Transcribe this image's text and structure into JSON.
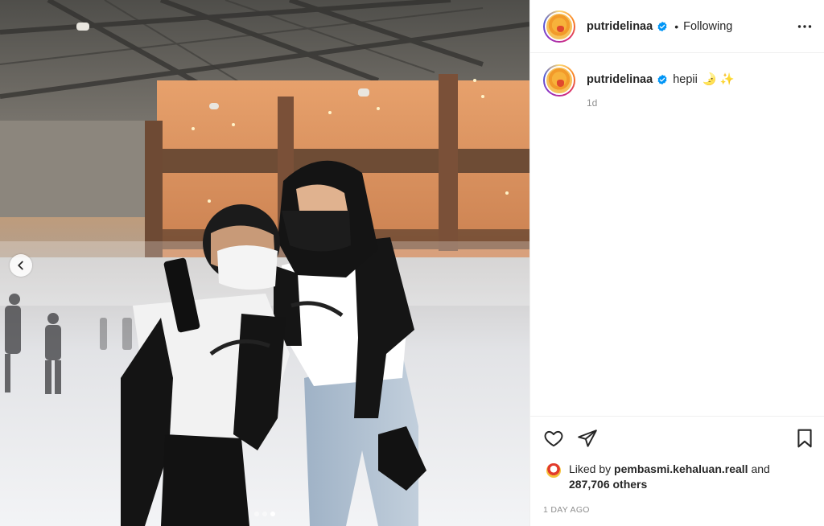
{
  "post": {
    "author": "putridelinaa",
    "follow_status": "Following",
    "separator": "•",
    "caption": {
      "text": "hepii",
      "emoji": "🌛 ✨",
      "time_ago": "1d"
    },
    "likes": {
      "prefix": "Liked by",
      "liker": "pembasmi.kehaluan.reall",
      "connector": "and",
      "others": "287,706 others"
    },
    "date": "1 DAY AGO"
  },
  "carousel": {
    "current_index": 3,
    "total": 3
  },
  "icons": {
    "avatar": "profile-avatar",
    "verified": "verified-badge-icon",
    "more": "more-options-icon",
    "prev": "chevron-left-icon",
    "like": "heart-icon",
    "share": "send-icon",
    "save": "bookmark-icon"
  },
  "colors": {
    "verified": "#0095f6",
    "text": "#262626",
    "muted": "#8e8e8e",
    "border": "#efefef"
  }
}
